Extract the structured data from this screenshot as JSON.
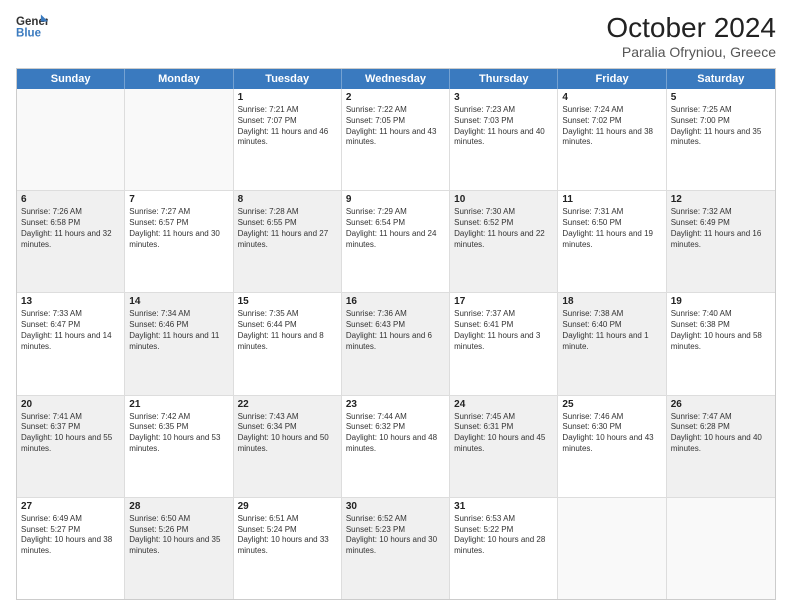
{
  "header": {
    "logo_line1": "General",
    "logo_line2": "Blue",
    "title": "October 2024",
    "subtitle": "Paralia Ofryniou, Greece"
  },
  "days_of_week": [
    "Sunday",
    "Monday",
    "Tuesday",
    "Wednesday",
    "Thursday",
    "Friday",
    "Saturday"
  ],
  "weeks": [
    {
      "cells": [
        {
          "day": "",
          "info": "",
          "empty": true
        },
        {
          "day": "",
          "info": "",
          "empty": true
        },
        {
          "day": "1",
          "info": "Sunrise: 7:21 AM\nSunset: 7:07 PM\nDaylight: 11 hours and 46 minutes."
        },
        {
          "day": "2",
          "info": "Sunrise: 7:22 AM\nSunset: 7:05 PM\nDaylight: 11 hours and 43 minutes."
        },
        {
          "day": "3",
          "info": "Sunrise: 7:23 AM\nSunset: 7:03 PM\nDaylight: 11 hours and 40 minutes."
        },
        {
          "day": "4",
          "info": "Sunrise: 7:24 AM\nSunset: 7:02 PM\nDaylight: 11 hours and 38 minutes."
        },
        {
          "day": "5",
          "info": "Sunrise: 7:25 AM\nSunset: 7:00 PM\nDaylight: 11 hours and 35 minutes."
        }
      ]
    },
    {
      "cells": [
        {
          "day": "6",
          "info": "Sunrise: 7:26 AM\nSunset: 6:58 PM\nDaylight: 11 hours and 32 minutes.",
          "shaded": true
        },
        {
          "day": "7",
          "info": "Sunrise: 7:27 AM\nSunset: 6:57 PM\nDaylight: 11 hours and 30 minutes."
        },
        {
          "day": "8",
          "info": "Sunrise: 7:28 AM\nSunset: 6:55 PM\nDaylight: 11 hours and 27 minutes.",
          "shaded": true
        },
        {
          "day": "9",
          "info": "Sunrise: 7:29 AM\nSunset: 6:54 PM\nDaylight: 11 hours and 24 minutes."
        },
        {
          "day": "10",
          "info": "Sunrise: 7:30 AM\nSunset: 6:52 PM\nDaylight: 11 hours and 22 minutes.",
          "shaded": true
        },
        {
          "day": "11",
          "info": "Sunrise: 7:31 AM\nSunset: 6:50 PM\nDaylight: 11 hours and 19 minutes."
        },
        {
          "day": "12",
          "info": "Sunrise: 7:32 AM\nSunset: 6:49 PM\nDaylight: 11 hours and 16 minutes.",
          "shaded": true
        }
      ]
    },
    {
      "cells": [
        {
          "day": "13",
          "info": "Sunrise: 7:33 AM\nSunset: 6:47 PM\nDaylight: 11 hours and 14 minutes."
        },
        {
          "day": "14",
          "info": "Sunrise: 7:34 AM\nSunset: 6:46 PM\nDaylight: 11 hours and 11 minutes.",
          "shaded": true
        },
        {
          "day": "15",
          "info": "Sunrise: 7:35 AM\nSunset: 6:44 PM\nDaylight: 11 hours and 8 minutes."
        },
        {
          "day": "16",
          "info": "Sunrise: 7:36 AM\nSunset: 6:43 PM\nDaylight: 11 hours and 6 minutes.",
          "shaded": true
        },
        {
          "day": "17",
          "info": "Sunrise: 7:37 AM\nSunset: 6:41 PM\nDaylight: 11 hours and 3 minutes."
        },
        {
          "day": "18",
          "info": "Sunrise: 7:38 AM\nSunset: 6:40 PM\nDaylight: 11 hours and 1 minute.",
          "shaded": true
        },
        {
          "day": "19",
          "info": "Sunrise: 7:40 AM\nSunset: 6:38 PM\nDaylight: 10 hours and 58 minutes."
        }
      ]
    },
    {
      "cells": [
        {
          "day": "20",
          "info": "Sunrise: 7:41 AM\nSunset: 6:37 PM\nDaylight: 10 hours and 55 minutes.",
          "shaded": true
        },
        {
          "day": "21",
          "info": "Sunrise: 7:42 AM\nSunset: 6:35 PM\nDaylight: 10 hours and 53 minutes."
        },
        {
          "day": "22",
          "info": "Sunrise: 7:43 AM\nSunset: 6:34 PM\nDaylight: 10 hours and 50 minutes.",
          "shaded": true
        },
        {
          "day": "23",
          "info": "Sunrise: 7:44 AM\nSunset: 6:32 PM\nDaylight: 10 hours and 48 minutes."
        },
        {
          "day": "24",
          "info": "Sunrise: 7:45 AM\nSunset: 6:31 PM\nDaylight: 10 hours and 45 minutes.",
          "shaded": true
        },
        {
          "day": "25",
          "info": "Sunrise: 7:46 AM\nSunset: 6:30 PM\nDaylight: 10 hours and 43 minutes."
        },
        {
          "day": "26",
          "info": "Sunrise: 7:47 AM\nSunset: 6:28 PM\nDaylight: 10 hours and 40 minutes.",
          "shaded": true
        }
      ]
    },
    {
      "cells": [
        {
          "day": "27",
          "info": "Sunrise: 6:49 AM\nSunset: 5:27 PM\nDaylight: 10 hours and 38 minutes."
        },
        {
          "day": "28",
          "info": "Sunrise: 6:50 AM\nSunset: 5:26 PM\nDaylight: 10 hours and 35 minutes.",
          "shaded": true
        },
        {
          "day": "29",
          "info": "Sunrise: 6:51 AM\nSunset: 5:24 PM\nDaylight: 10 hours and 33 minutes."
        },
        {
          "day": "30",
          "info": "Sunrise: 6:52 AM\nSunset: 5:23 PM\nDaylight: 10 hours and 30 minutes.",
          "shaded": true
        },
        {
          "day": "31",
          "info": "Sunrise: 6:53 AM\nSunset: 5:22 PM\nDaylight: 10 hours and 28 minutes."
        },
        {
          "day": "",
          "info": "",
          "empty": true
        },
        {
          "day": "",
          "info": "",
          "empty": true
        }
      ]
    }
  ]
}
